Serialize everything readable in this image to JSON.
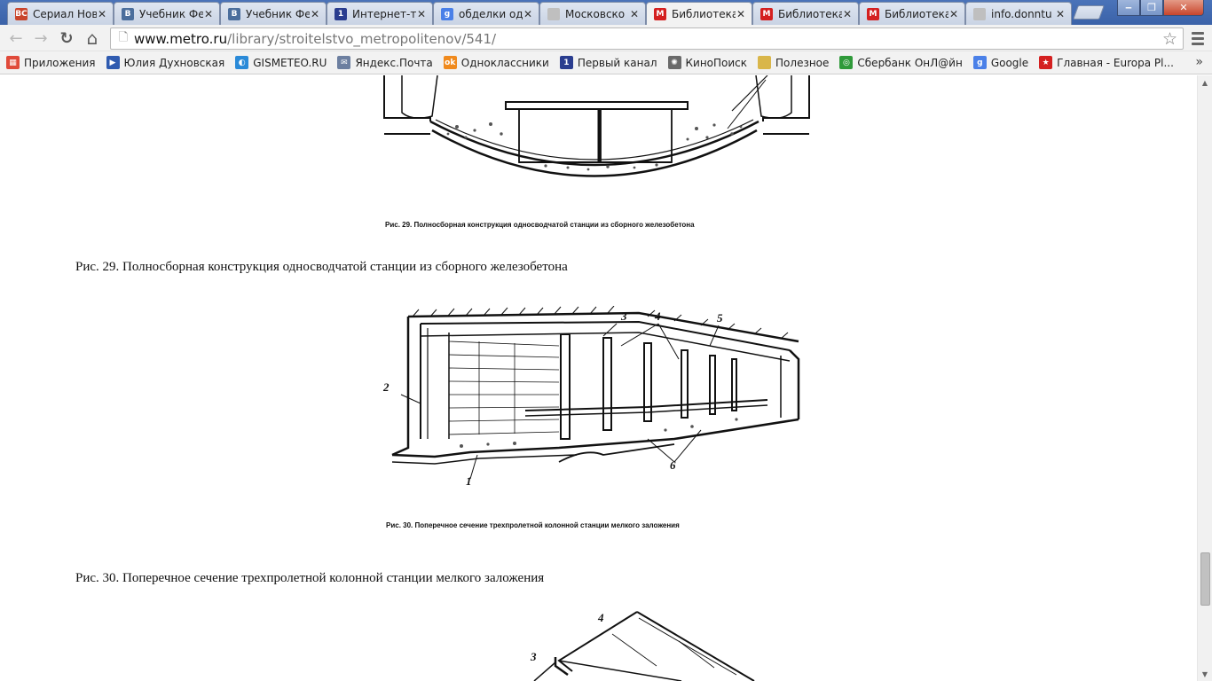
{
  "tabs": [
    {
      "title": "Сериал Нов",
      "icon": "vk-bc-icon",
      "color": "#c9452c",
      "glyph": "BC"
    },
    {
      "title": "Учебник Фе",
      "icon": "vk-icon",
      "color": "#4b6e9c",
      "glyph": "B"
    },
    {
      "title": "Учебник Фе",
      "icon": "vk-icon",
      "color": "#4b6e9c",
      "glyph": "B"
    },
    {
      "title": "Интернет-те",
      "icon": "channel-one-icon",
      "color": "#2a3d8f",
      "glyph": "1"
    },
    {
      "title": "обделки одн",
      "icon": "google-icon",
      "color": "#4a80e8",
      "glyph": "g"
    },
    {
      "title": "Московско",
      "icon": "page-icon",
      "color": "#bfbfbf",
      "glyph": ""
    },
    {
      "title": "Библиотека",
      "icon": "metro-icon",
      "color": "#d42020",
      "glyph": "M",
      "active": true
    },
    {
      "title": "Библиотека",
      "icon": "metro-icon",
      "color": "#d42020",
      "glyph": "M"
    },
    {
      "title": "Библиотека",
      "icon": "metro-icon",
      "color": "#d42020",
      "glyph": "M"
    },
    {
      "title": "info.donntu",
      "icon": "page-icon",
      "color": "#bfbfbf",
      "glyph": ""
    }
  ],
  "tab_close_glyph": "✕",
  "window_controls": {
    "minimize": "‒",
    "maximize": "❐",
    "close": "✕"
  },
  "toolbar": {
    "back": "←",
    "forward": "→",
    "reload": "↻",
    "home": "⌂"
  },
  "address": {
    "host": "www.metro.ru",
    "path": "/library/stroitelstvo_metropolitenov/541/",
    "star": "☆"
  },
  "bookmarks": [
    {
      "label": "Приложения",
      "icon": "apps-icon",
      "color": "#e04a3a",
      "glyph": "▦"
    },
    {
      "label": "Юлия Духновская",
      "icon": "video-icon",
      "color": "#2f5bb0",
      "glyph": "▶"
    },
    {
      "label": "GISMETEO.RU",
      "icon": "gismeteo-icon",
      "color": "#2a8ad8",
      "glyph": "◐"
    },
    {
      "label": "Яндекс.Почта",
      "icon": "mail-icon",
      "color": "#6c7fa0",
      "glyph": "✉"
    },
    {
      "label": "Одноклассники",
      "icon": "ok-icon",
      "color": "#f08a1d",
      "glyph": "ok"
    },
    {
      "label": "Первый канал",
      "icon": "channel-one-icon",
      "color": "#2a3d8f",
      "glyph": "1"
    },
    {
      "label": "КиноПоиск",
      "icon": "film-icon",
      "color": "#6a6a6a",
      "glyph": "✺"
    },
    {
      "label": "Полезное",
      "icon": "folder-icon",
      "color": "#d9b64a",
      "glyph": ""
    },
    {
      "label": "Сбербанк ОнЛ@йн",
      "icon": "sberbank-icon",
      "color": "#2f9a3a",
      "glyph": "◎"
    },
    {
      "label": "Google",
      "icon": "google-icon",
      "color": "#4a80e8",
      "glyph": "g"
    },
    {
      "label": "Главная - Europa Pl...",
      "icon": "europa-star-icon",
      "color": "#d42020",
      "glyph": "★"
    }
  ],
  "bookmarks_more": "»",
  "content": {
    "fig29_small_caption": "Рис. 29. Полносборная конструкция односводчатой станции из сборного железобетона",
    "fig29_caption": "Рис. 29. Полносборная конструкция односводчатой станции из сборного железобетона",
    "fig30_labels": [
      "1",
      "2",
      "3",
      "4",
      "5",
      "6"
    ],
    "fig30_small_caption": "Рис. 30. Поперечное сечение трехпролетной колонной станции мелкого заложения",
    "fig30_caption": "Рис. 30. Поперечное сечение трехпролетной колонной станции мелкого заложения",
    "fig31_labels": [
      "3",
      "4"
    ]
  },
  "scroll": {
    "up": "▲",
    "down": "▼",
    "position": 0.82
  }
}
